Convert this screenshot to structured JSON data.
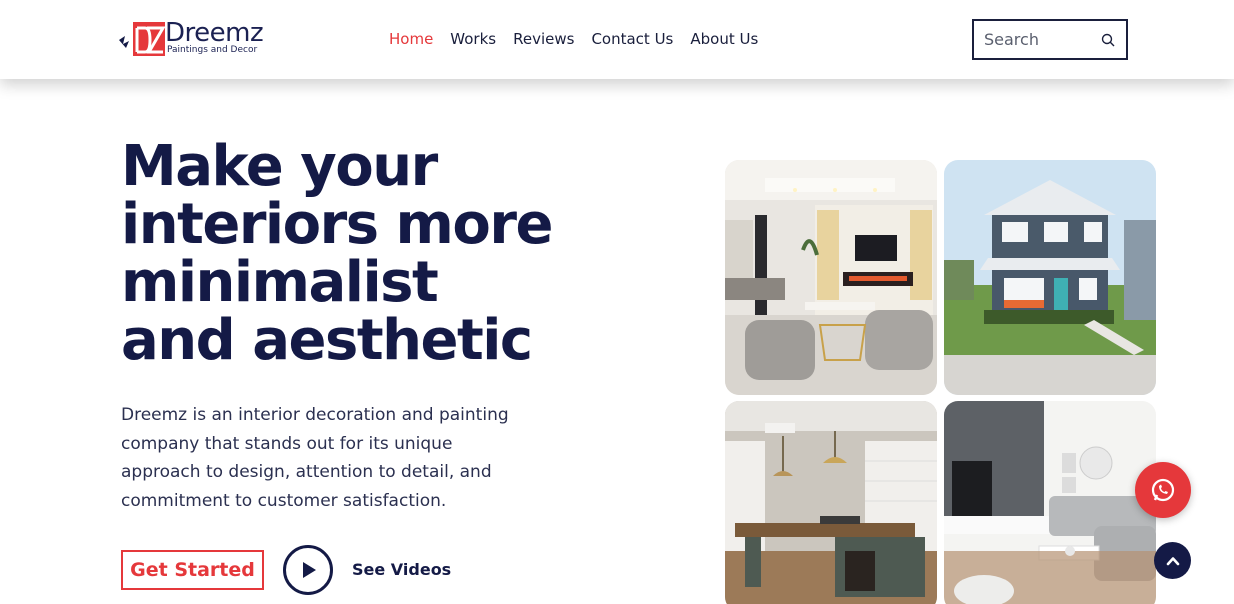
{
  "brand": {
    "name": "Dreemz",
    "tagline": "Paintings and Decor",
    "mark_letters": "DZ",
    "accent_color": "#e5383b",
    "navy_color": "#141a46"
  },
  "nav": {
    "items": [
      {
        "label": "Home",
        "active": true
      },
      {
        "label": "Works",
        "active": false
      },
      {
        "label": "Reviews",
        "active": false
      },
      {
        "label": "Contact Us",
        "active": false
      },
      {
        "label": "About Us",
        "active": false
      }
    ]
  },
  "search": {
    "placeholder": "Search",
    "icon": "search-icon"
  },
  "hero": {
    "title_lines": [
      "Make your",
      "interiors more",
      "minimalist",
      "and aesthetic"
    ],
    "description": "Dreemz is an interior decoration and painting company that stands out for its unique approach to design, attention to detail, and commitment to customer satisfaction.",
    "cta_label": "Get Started",
    "video_label": "See Videos",
    "video_icon": "play-icon"
  },
  "gallery": [
    {
      "name": "living-room-fireplace-photo"
    },
    {
      "name": "blue-house-exterior-photo"
    },
    {
      "name": "office-room-photo"
    },
    {
      "name": "grey-sofa-living-room-photo"
    }
  ],
  "floating": {
    "whatsapp_icon": "whatsapp-icon",
    "back_to_top_icon": "chevron-up-icon"
  }
}
